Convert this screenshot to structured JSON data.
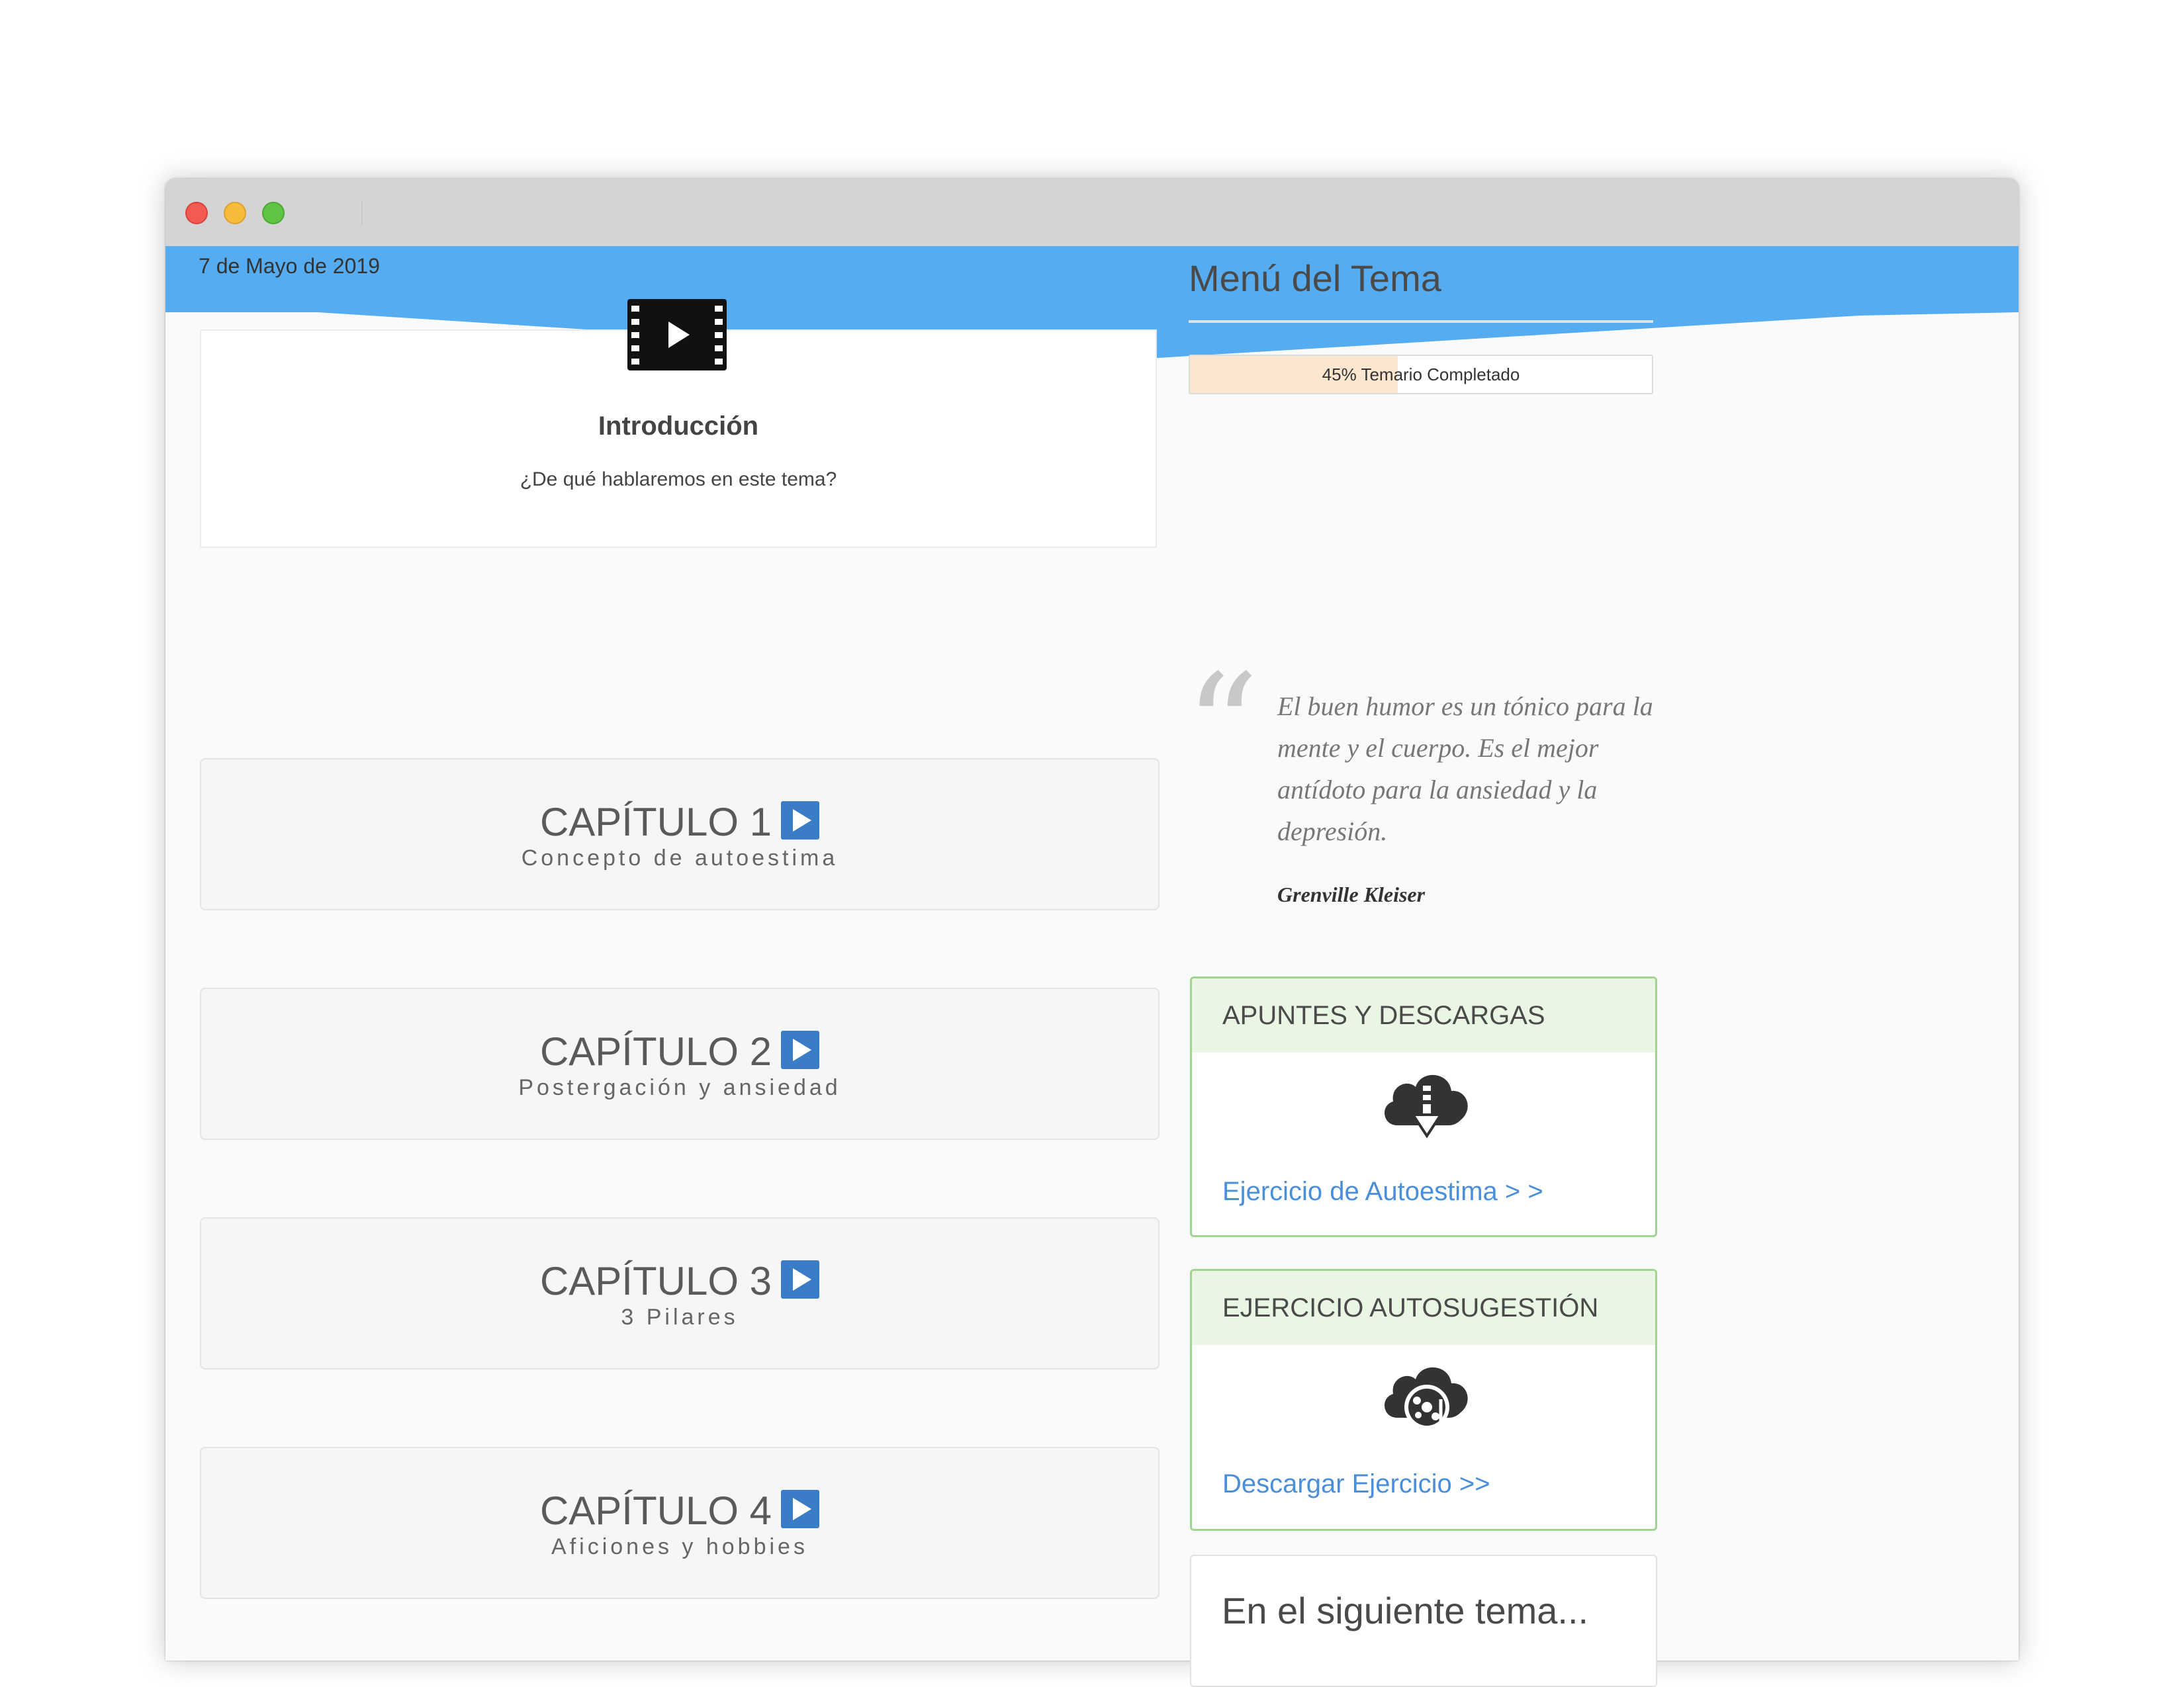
{
  "date": "7 de Mayo de 2019",
  "intro": {
    "icon": "film-play-icon",
    "title": "Introducción",
    "subtitle": "¿De qué hablaremos en este tema?"
  },
  "chapters": [
    {
      "title": "CAPÍTULO 1",
      "subtitle": "Concepto de autoestima"
    },
    {
      "title": "CAPÍTULO 2",
      "subtitle": "Postergación y ansiedad"
    },
    {
      "title": "CAPÍTULO 3",
      "subtitle": "3 Pilares"
    },
    {
      "title": "CAPÍTULO 4",
      "subtitle": "Aficiones y hobbies"
    }
  ],
  "sidebar": {
    "title": "Menú del Tema",
    "progress": {
      "percent": 45,
      "label": "45% Temario Completado"
    },
    "quote": {
      "text": "El buen humor es un tónico para la mente y el cuerpo. Es el mejor antídoto para la ansiedad y la depresión.",
      "author": "Grenville Kleiser"
    },
    "panels": [
      {
        "title": "APUNTES Y DESCARGAS",
        "icon": "cloud-download-icon",
        "link": "Ejercicio de Autoestima > >"
      },
      {
        "title": "EJERCICIO AUTOSUGESTIÓN",
        "icon": "cloud-music-icon",
        "link": "Descargar Ejercicio >>"
      }
    ],
    "next": {
      "title": "En el siguiente tema..."
    }
  },
  "colors": {
    "banner": "#56acf1",
    "accent_link": "#4a8fd9",
    "panel_border": "#9fd68e",
    "panel_header": "#e9f6e4",
    "progress_fill": "#fbe6cf",
    "chapter_play": "#3a7dc6"
  }
}
